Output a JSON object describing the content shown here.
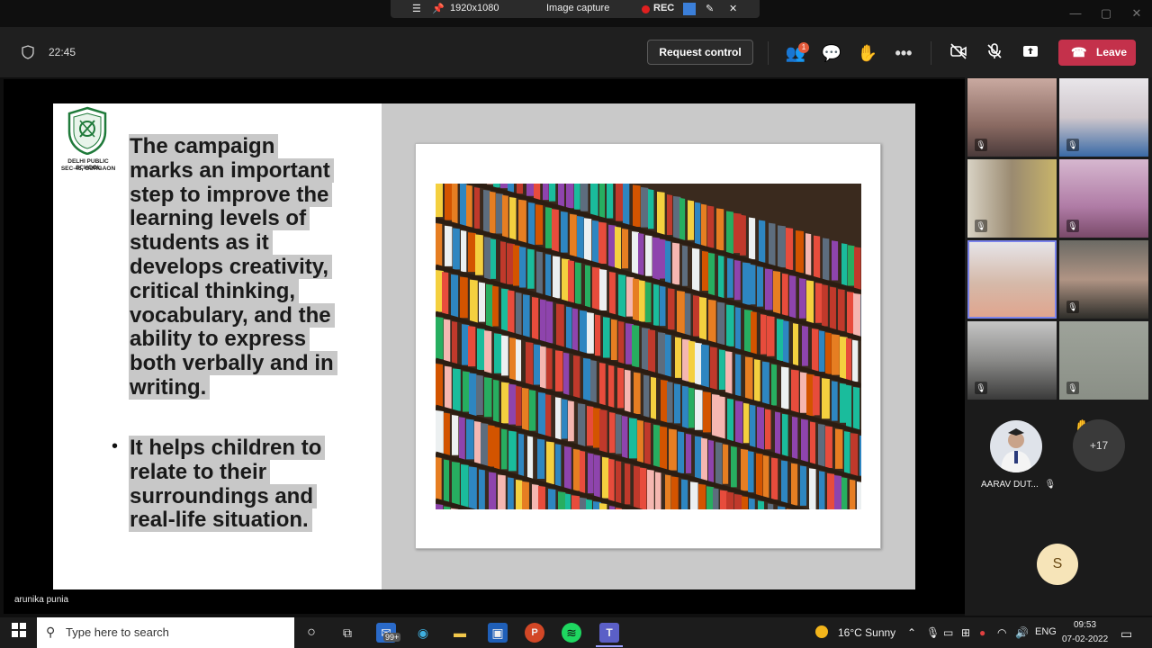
{
  "capture_bar": {
    "resolution": "1920x1080",
    "mode": "Image capture",
    "rec": "REC"
  },
  "header": {
    "time": "22:45",
    "request_control": "Request control",
    "people_badge": "1",
    "leave": "Leave"
  },
  "slide": {
    "school_name": "DELHI PUBLIC SCHOOL",
    "school_location": "SEC-45, GURGAON",
    "para1_lines": [
      "The campaign",
      "marks an important",
      "step to improve the",
      "learning levels of",
      "students as it",
      "develops creativity,",
      "critical thinking,",
      "vocabulary, and the",
      "ability to express",
      "both verbally and in",
      "writing."
    ],
    "bullet": "•",
    "para2_lines": [
      "It helps children to",
      "relate to their",
      "surroundings and",
      "real-life situation."
    ]
  },
  "presenter": "arunika punia",
  "gallery": {
    "overflow_count": "+17",
    "attendee_name": "AARAV DUT...",
    "initial_avatar": "S"
  },
  "taskbar": {
    "search_placeholder": "Type here to search",
    "mail_badge": "99+",
    "weather": "16°C  Sunny",
    "lang": "ENG",
    "clock_time": "09:53",
    "clock_date": "07-02-2022"
  },
  "colors": {
    "leave": "#c4314b",
    "header_bg": "#1f1f1f",
    "slide_highlight": "#c8c8c8"
  }
}
